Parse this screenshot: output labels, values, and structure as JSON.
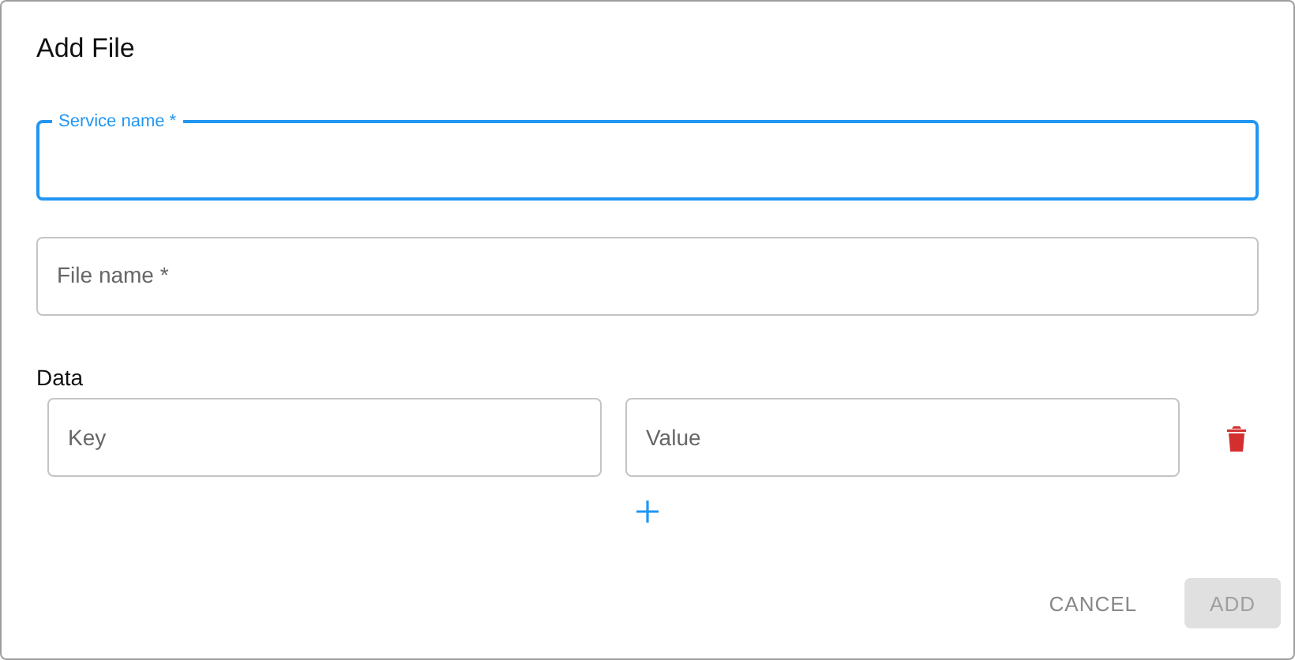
{
  "dialog": {
    "title": "Add File"
  },
  "fields": [
    {
      "label": "Service name *",
      "focused": true
    },
    {
      "label": "File name *",
      "focused": false
    }
  ],
  "data": {
    "label": "Data",
    "rows": [
      {
        "key_placeholder": "Key",
        "value_placeholder": "Value"
      }
    ]
  },
  "buttons": [
    {
      "label": "CANCEL",
      "kind": "text",
      "disabled": false
    },
    {
      "label": "ADD",
      "kind": "contained",
      "disabled": true
    }
  ]
}
